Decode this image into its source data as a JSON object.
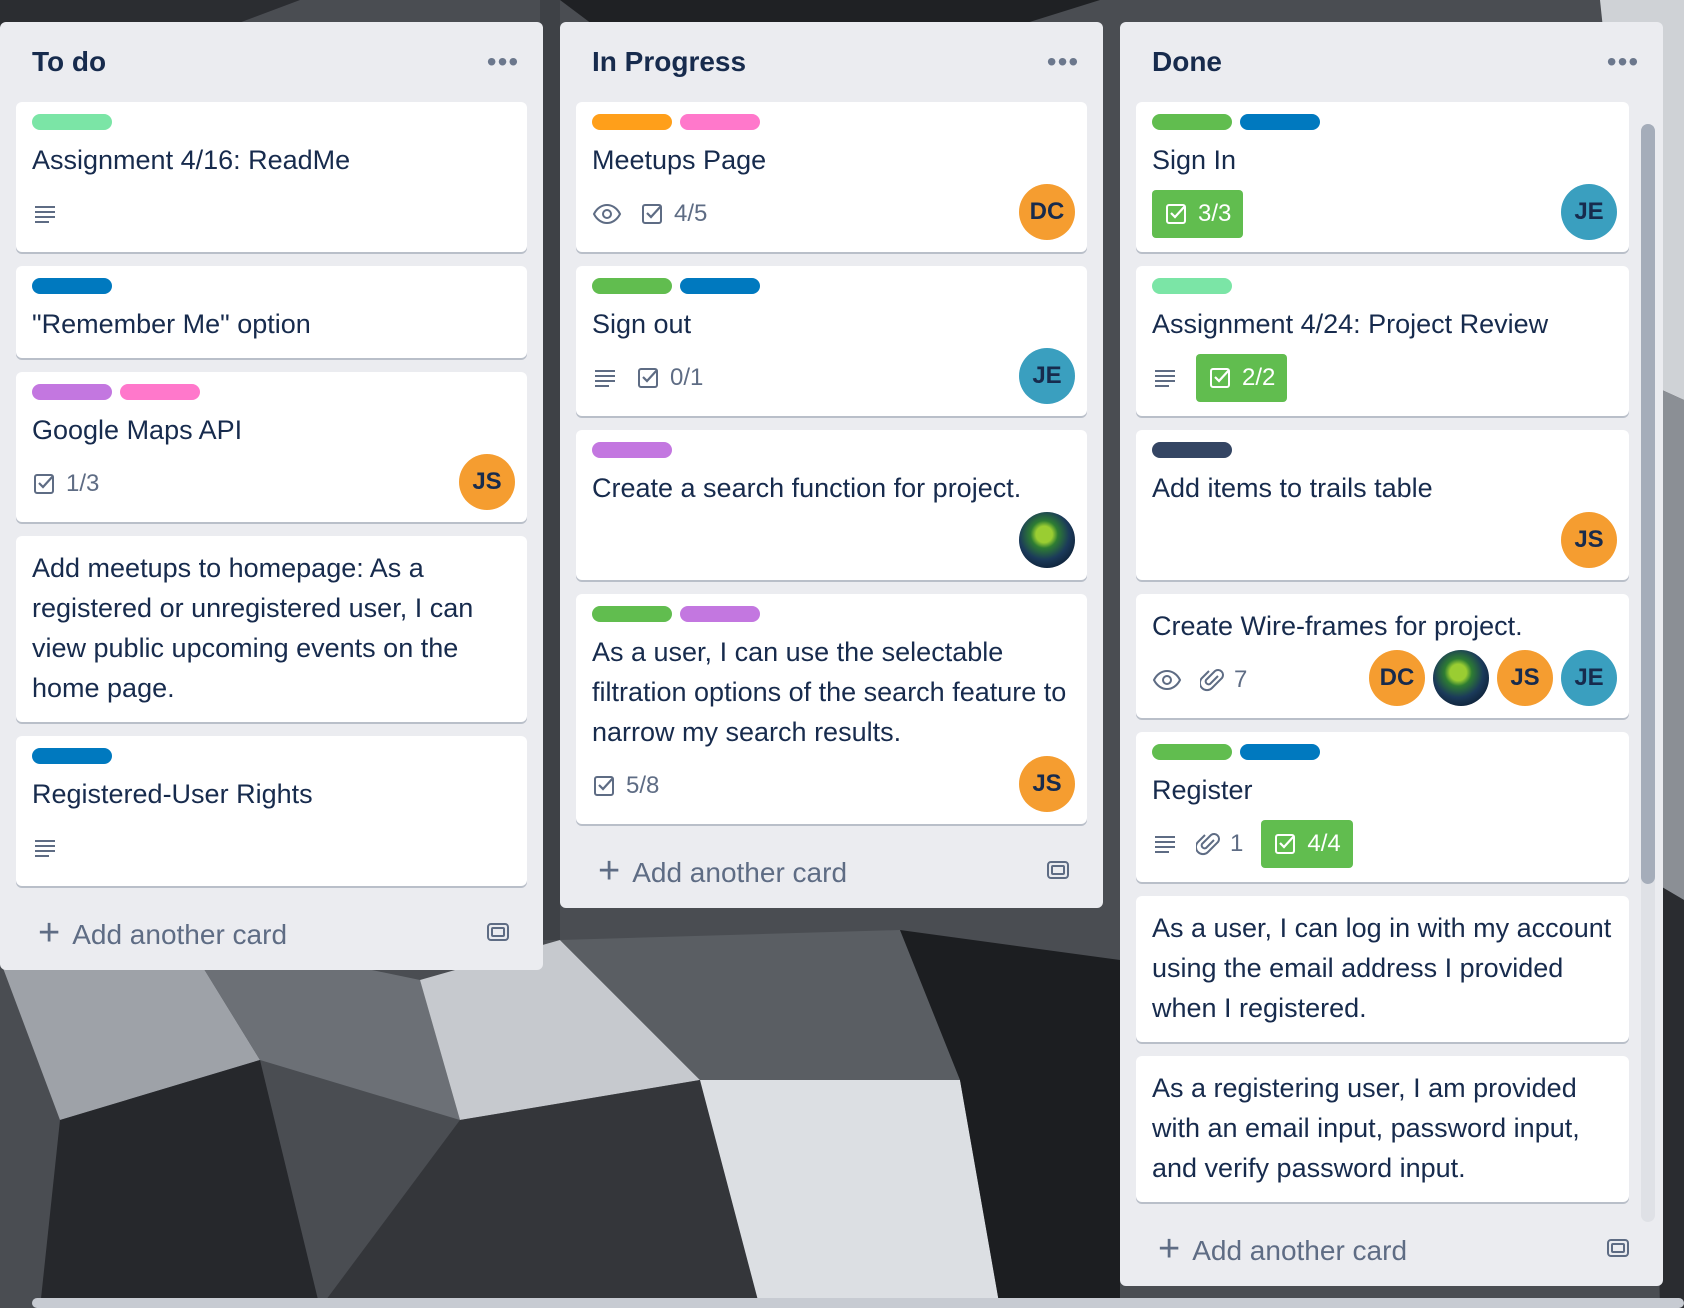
{
  "colors": {
    "green": "#61bd4f",
    "mint": "#7be5a6",
    "orange": "#ff9f1a",
    "pink": "#ff78cb",
    "blue": "#0079bf",
    "purple": "#c377e0",
    "navy": "#344563",
    "avatar_orange": "#f59d30",
    "avatar_teal": "#3a9fbf"
  },
  "lists": [
    {
      "title": "To do",
      "add_label": "Add another card",
      "cards": [
        {
          "labels": [
            "mint"
          ],
          "title": "Assignment 4/16: ReadMe",
          "badges": [
            {
              "icon": "description-icon"
            }
          ],
          "avatars": []
        },
        {
          "labels": [
            "blue"
          ],
          "title": "\"Remember Me\" option",
          "badges": [],
          "avatars": []
        },
        {
          "labels": [
            "purple",
            "pink"
          ],
          "title": "Google Maps API",
          "badges": [
            {
              "icon": "checklist-icon",
              "text": "1/3"
            }
          ],
          "avatars": [
            {
              "initials": "JS",
              "color": "avatar_orange"
            }
          ]
        },
        {
          "labels": [],
          "title": "Add meetups to homepage: As a registered or unregistered user, I can view public upcoming events on the home page.",
          "badges": [],
          "avatars": []
        },
        {
          "labels": [
            "blue"
          ],
          "title": "Registered-User Rights",
          "badges": [
            {
              "icon": "description-icon"
            }
          ],
          "avatars": []
        }
      ]
    },
    {
      "title": "In Progress",
      "add_label": "Add another card",
      "cards": [
        {
          "labels": [
            "orange",
            "pink"
          ],
          "title": "Meetups Page",
          "badges": [
            {
              "icon": "watch-icon"
            },
            {
              "icon": "checklist-icon",
              "text": "4/5"
            }
          ],
          "avatars": [
            {
              "initials": "DC",
              "color": "avatar_orange"
            }
          ]
        },
        {
          "labels": [
            "green",
            "blue"
          ],
          "title": "Sign out",
          "badges": [
            {
              "icon": "description-icon"
            },
            {
              "icon": "checklist-icon",
              "text": "0/1"
            }
          ],
          "avatars": [
            {
              "initials": "JE",
              "color": "avatar_teal"
            }
          ]
        },
        {
          "labels": [
            "purple"
          ],
          "title": "Create a search function for project.",
          "badges": [],
          "avatars": [
            {
              "photo": true
            }
          ]
        },
        {
          "labels": [
            "green",
            "purple"
          ],
          "title": "As a user, I can use the selectable filtration options of the search feature to narrow my search results.",
          "badges": [
            {
              "icon": "checklist-icon",
              "text": "5/8"
            }
          ],
          "avatars": [
            {
              "initials": "JS",
              "color": "avatar_orange"
            }
          ]
        }
      ]
    },
    {
      "title": "Done",
      "add_label": "Add another card",
      "cards": [
        {
          "labels": [
            "green",
            "blue"
          ],
          "title": "Sign In",
          "badges": [
            {
              "icon": "checklist-icon",
              "text": "3/3",
              "complete": true
            }
          ],
          "avatars": [
            {
              "initials": "JE",
              "color": "avatar_teal"
            }
          ]
        },
        {
          "labels": [
            "mint"
          ],
          "title": "Assignment 4/24: Project Review",
          "badges": [
            {
              "icon": "description-icon"
            },
            {
              "icon": "checklist-icon",
              "text": "2/2",
              "complete": true
            }
          ],
          "avatars": []
        },
        {
          "labels": [
            "navy"
          ],
          "title": "Add items to trails table",
          "badges": [
            {
              "spacer": true
            }
          ],
          "avatars": [
            {
              "initials": "JS",
              "color": "avatar_orange"
            }
          ]
        },
        {
          "labels": [],
          "title": "Create Wire-frames for project.",
          "badges": [
            {
              "icon": "watch-icon"
            },
            {
              "icon": "attachment-icon",
              "text": "7"
            }
          ],
          "avatars": [
            {
              "initials": "DC",
              "color": "avatar_orange"
            },
            {
              "photo": true
            },
            {
              "initials": "JS",
              "color": "avatar_orange"
            },
            {
              "initials": "JE",
              "color": "avatar_teal"
            }
          ]
        },
        {
          "labels": [
            "green",
            "blue"
          ],
          "title": "Register",
          "badges": [
            {
              "icon": "description-icon"
            },
            {
              "icon": "attachment-icon",
              "text": "1"
            },
            {
              "icon": "checklist-icon",
              "text": "4/4",
              "complete": true
            }
          ],
          "avatars": []
        },
        {
          "labels": [],
          "title": "As a user, I can log in with my account using the email address I provided when I registered.",
          "badges": [],
          "avatars": []
        },
        {
          "labels": [],
          "title": "As a registering user, I am provided with an email input, password input, and verify password input.",
          "badges": [],
          "avatars": []
        }
      ]
    }
  ]
}
